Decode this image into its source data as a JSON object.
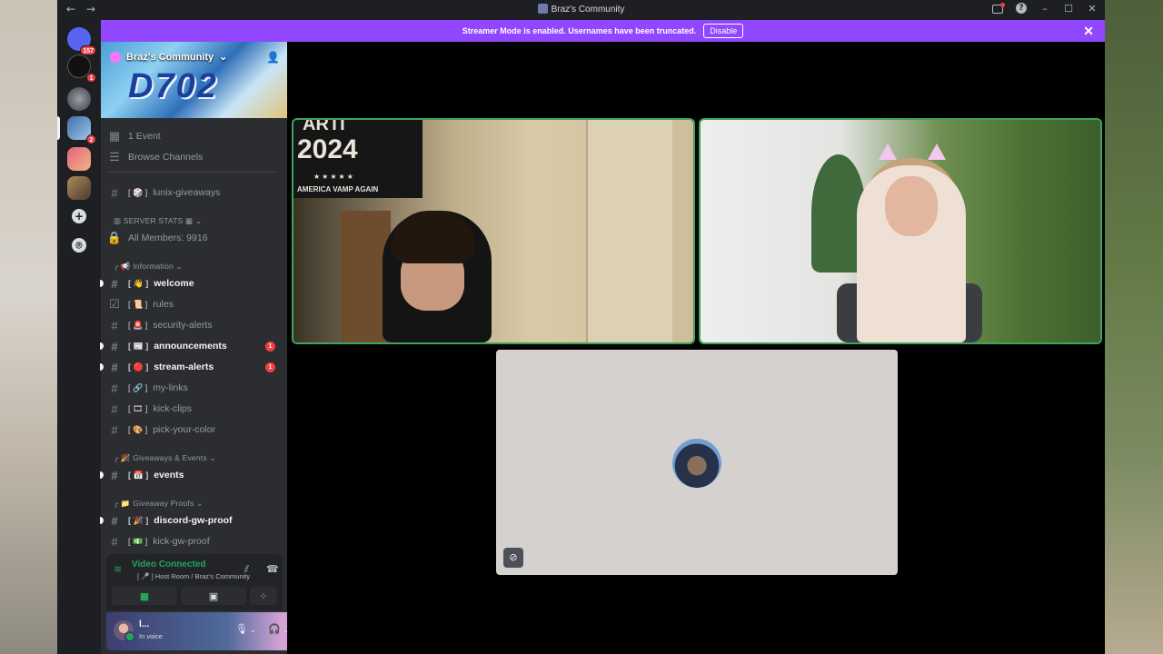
{
  "window": {
    "title": "Braz's Community",
    "nav_arrows": "← →"
  },
  "streamer_banner": {
    "text": "Streamer Mode is enabled. Usernames have been truncated.",
    "button": "Disable",
    "close": "✕"
  },
  "guilds": {
    "home_badge": "157",
    "badges": [
      "1",
      "2"
    ],
    "add_icon": "+",
    "explore_icon": "⌾"
  },
  "server": {
    "name": "Braz's Community",
    "banner_art": "D702",
    "events": "1 Event",
    "browse": "Browse Channels"
  },
  "channels": {
    "giveaways": {
      "emoji": "[ 🎲 ]",
      "label": "lunix-giveaways"
    },
    "server_stats_cat": "SERVER STATS",
    "all_members": "All Members: 9916",
    "information_cat": "Information",
    "welcome": {
      "emoji": "[ 👋 ]",
      "label": "welcome"
    },
    "rules": {
      "emoji": "[ 📜 ]",
      "label": "rules"
    },
    "security": {
      "emoji": "[ 🚨 ]",
      "label": "security-alerts"
    },
    "announcements": {
      "emoji": "[ 📰 ]",
      "label": "announcements",
      "badge": "1"
    },
    "stream": {
      "emoji": "[ 🔴 ]",
      "label": "stream-alerts",
      "badge": "1"
    },
    "links": {
      "emoji": "[ 🔗 ]",
      "label": "my-links"
    },
    "kick": {
      "emoji": "[ 🎞 ]",
      "label": "kick-clips"
    },
    "color": {
      "emoji": "[ 🎨 ]",
      "label": "pick-your-color"
    },
    "events_cat": "Giveaways & Events",
    "events": {
      "emoji": "[ 📅 ]",
      "label": "events"
    },
    "proofs_cat": "Giveaway Proofs",
    "discord_proof": {
      "emoji": "[ 🎉 ]",
      "label": "discord-gw-proof"
    },
    "kick_proof": {
      "emoji": "[ 💵 ]",
      "label": "kick-gw-proof"
    }
  },
  "voice": {
    "status": "Video Connected",
    "room": "[ 🎤 ] Host Room / Braz's Community"
  },
  "user": {
    "name": "l...",
    "status": "In voice"
  },
  "stage": {
    "poster_top": "ARTI",
    "poster_year": "2024",
    "poster_stars": "★★★★★",
    "poster_slogan": "AMERICA VAMP AGAIN"
  },
  "colors": {
    "accent": "#9147ff",
    "speaking": "#3ba55d",
    "connected": "#23a55a",
    "badge": "#f23f43"
  }
}
